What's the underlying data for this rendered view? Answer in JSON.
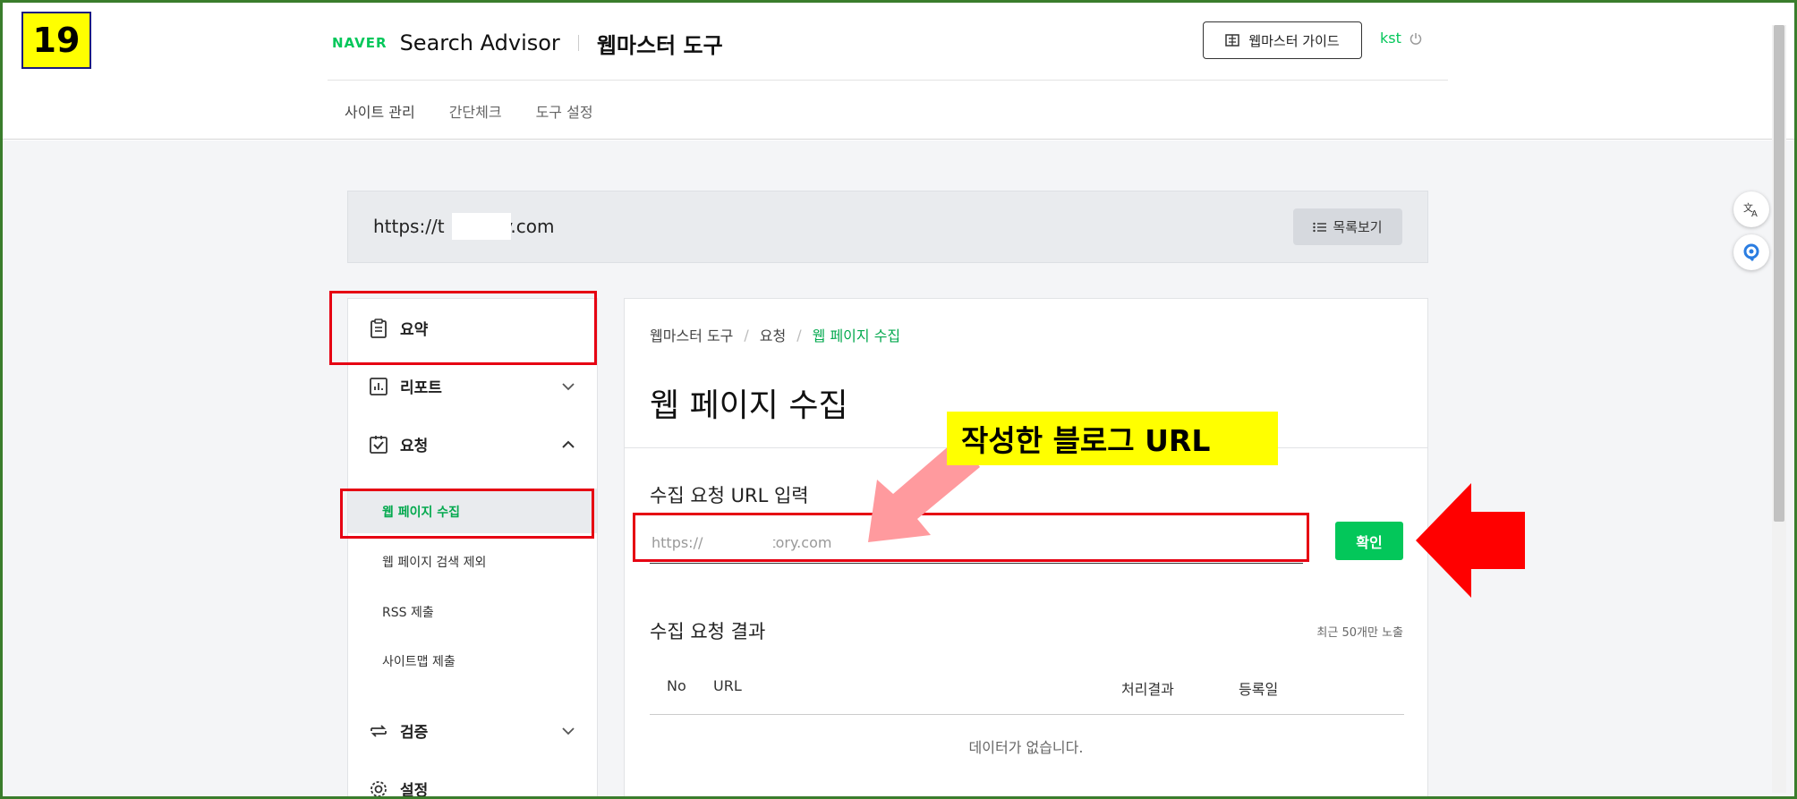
{
  "step_badge": "19",
  "header": {
    "brand": "NAVER",
    "product": "Search Advisor",
    "tool_name": "웹마스터 도구",
    "guide_button": "웹마스터 가이드",
    "user": "kst"
  },
  "tabs": [
    {
      "label": "사이트 관리",
      "active": true
    },
    {
      "label": "간단체크",
      "active": false
    },
    {
      "label": "도구 설정",
      "active": false
    }
  ],
  "site_bar": {
    "url": "https://t         .tistory.com",
    "list_button": "목록보기"
  },
  "sidebar": {
    "items": [
      {
        "label": "요약",
        "icon": "clipboard-icon"
      },
      {
        "label": "리포트",
        "icon": "chart-icon",
        "expanded": false
      },
      {
        "label": "요청",
        "icon": "checked-box-icon",
        "expanded": true
      },
      {
        "label": "검증",
        "icon": "repeat-icon",
        "expanded": false
      },
      {
        "label": "설정",
        "icon": "gear-icon"
      }
    ],
    "sub_items": [
      {
        "label": "웹 페이지 수집",
        "active": true
      },
      {
        "label": "웹 페이지 검색 제외",
        "active": false
      },
      {
        "label": "RSS 제출",
        "active": false
      },
      {
        "label": "사이트맵 제출",
        "active": false
      }
    ]
  },
  "main": {
    "breadcrumb": [
      "웹마스터 도구",
      "요청",
      "웹 페이지 수집"
    ],
    "page_title": "웹 페이지 수집",
    "input_label": "수집 요청 URL 입력",
    "input_value": "https://          .tistory.com",
    "confirm_button": "확인",
    "result_title": "수집 요청 결과",
    "result_note": "최근 50개만 노출",
    "table_headers": [
      "No",
      "URL",
      "처리결과",
      "등록일"
    ],
    "empty_message": "데이터가 없습니다."
  },
  "annotation": {
    "callout_text": "작성한 블로그 URL",
    "highlight_color": "#e60012",
    "callout_color": "#ffff00"
  },
  "colors": {
    "brand_green": "#03c75a",
    "frame_green": "#3a7d2c"
  }
}
